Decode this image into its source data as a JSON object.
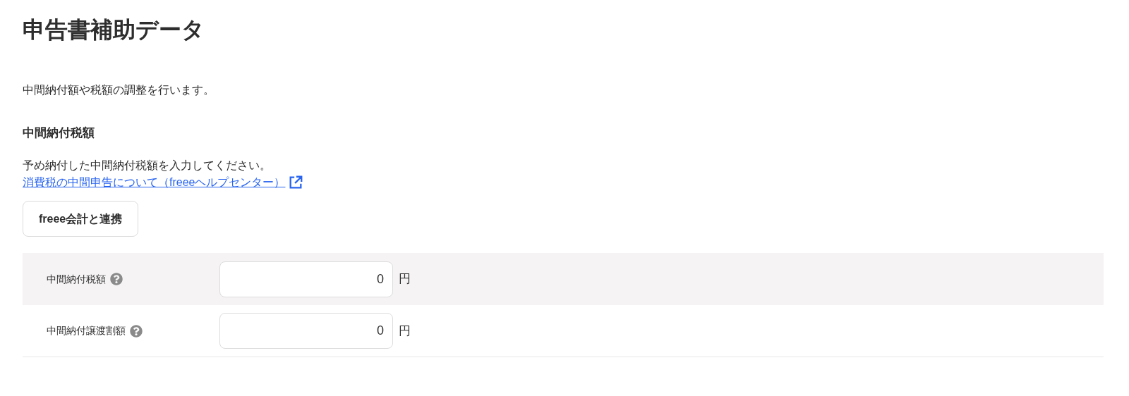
{
  "page_title": "申告書補助データ",
  "description": "中間納付額や税額の調整を行います。",
  "section": {
    "heading": "中間納付税額",
    "text": "予め納付した中間納付税額を入力してください。",
    "help_link": "消費税の中間申告について（freeeヘルプセンター）",
    "button": "freee会計と連携"
  },
  "rows": [
    {
      "label": "中間納付税額",
      "value": "0",
      "unit": "円"
    },
    {
      "label": "中間納付譲渡割額",
      "value": "0",
      "unit": "円"
    }
  ]
}
